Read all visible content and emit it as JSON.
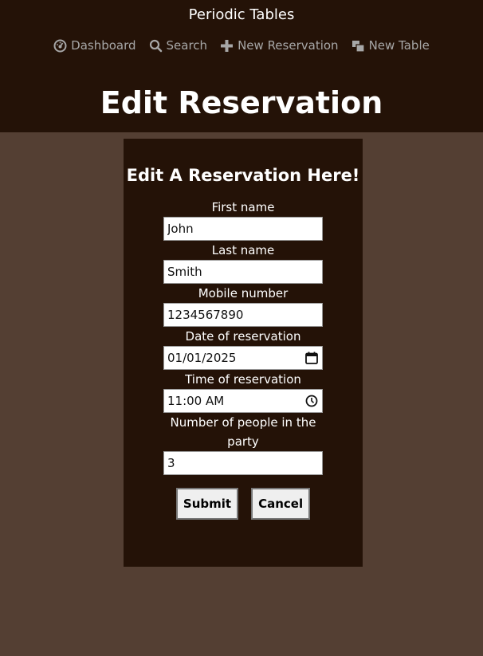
{
  "header": {
    "app_title": "Periodic Tables",
    "nav": [
      {
        "label": "Dashboard",
        "icon": "dashboard-icon"
      },
      {
        "label": "Search",
        "icon": "search-icon"
      },
      {
        "label": "New Reservation",
        "icon": "plus-icon"
      },
      {
        "label": "New Table",
        "icon": "table-icon"
      }
    ],
    "page_title": "Edit Reservation"
  },
  "form": {
    "title": "Edit A Reservation Here!",
    "first_name": {
      "label": "First name",
      "value": "John"
    },
    "last_name": {
      "label": "Last name",
      "value": "Smith"
    },
    "mobile": {
      "label": "Mobile number",
      "value": "1234567890"
    },
    "date": {
      "label": "Date of reservation",
      "value": "01/01/2025",
      "icon": "calendar-icon"
    },
    "time": {
      "label": "Time of reservation",
      "value": "11:00 AM",
      "icon": "clock-icon"
    },
    "people": {
      "label": "Number of people in the party",
      "value": "3"
    },
    "submit_label": "Submit",
    "cancel_label": "Cancel"
  },
  "colors": {
    "header_bg": "#241207",
    "page_bg": "#543f33",
    "card_bg": "#241207",
    "nav_text": "#a7a7a7"
  }
}
